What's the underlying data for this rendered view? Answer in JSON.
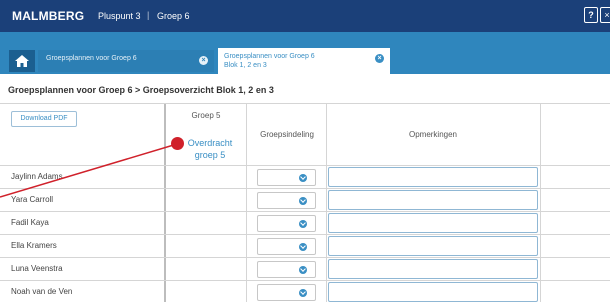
{
  "topbar": {
    "logo": "MALMBERG",
    "product": "Pluspunt 3",
    "separator": "|",
    "group": "Groep 6",
    "help_label": "?",
    "close_label": "×"
  },
  "tabs": [
    {
      "label": "Groepsplannen voor Groep 6",
      "close": "×"
    },
    {
      "label_line1": "Groepsplannen voor Groep 6",
      "label_line2": "Blok 1, 2 en 3",
      "close": "×"
    }
  ],
  "breadcrumb": "Groepsplannen voor Groep 6 > Groepsoverzicht Blok 1, 2 en 3",
  "toolbar": {
    "download_label": "Download PDF"
  },
  "columns": {
    "groep5": "Groep 5",
    "overdracht_line1": "Overdracht",
    "overdracht_line2": "groep 5",
    "groepsindeling": "Groepsindeling",
    "opmerkingen": "Opmerkingen"
  },
  "students": [
    "Jaylinn Adams",
    "Yara Carroll",
    "Fadil Kaya",
    "Ella Kramers",
    "Luna Veenstra",
    "Noah van de Ven"
  ],
  "colors": {
    "topbar": "#1b4079",
    "tabbar": "#2f86bd",
    "accent": "#3a8fc4",
    "marker": "#d0212b"
  }
}
